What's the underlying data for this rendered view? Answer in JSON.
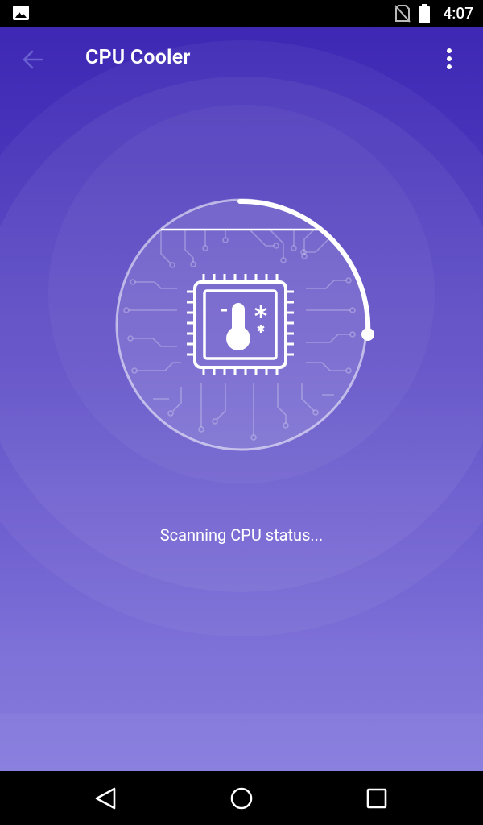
{
  "status_bar": {
    "time": "4:07",
    "icons": [
      "gallery-icon",
      "no-sim-icon",
      "battery-icon"
    ]
  },
  "app_bar": {
    "title": "CPU Cooler",
    "back_icon": "arrow-back-icon",
    "menu_icon": "more-vert-icon"
  },
  "scanner": {
    "icon": "cpu-thermometer-icon",
    "progress_fraction": 0.28
  },
  "scan_status": "Scanning CPU status...",
  "nav_bar": {
    "buttons": [
      "nav-back-icon",
      "nav-home-icon",
      "nav-recents-icon"
    ]
  },
  "colors": {
    "gradient_top": "#3b25b3",
    "gradient_bottom": "#8a7fdf",
    "accent": "#ffffff"
  }
}
